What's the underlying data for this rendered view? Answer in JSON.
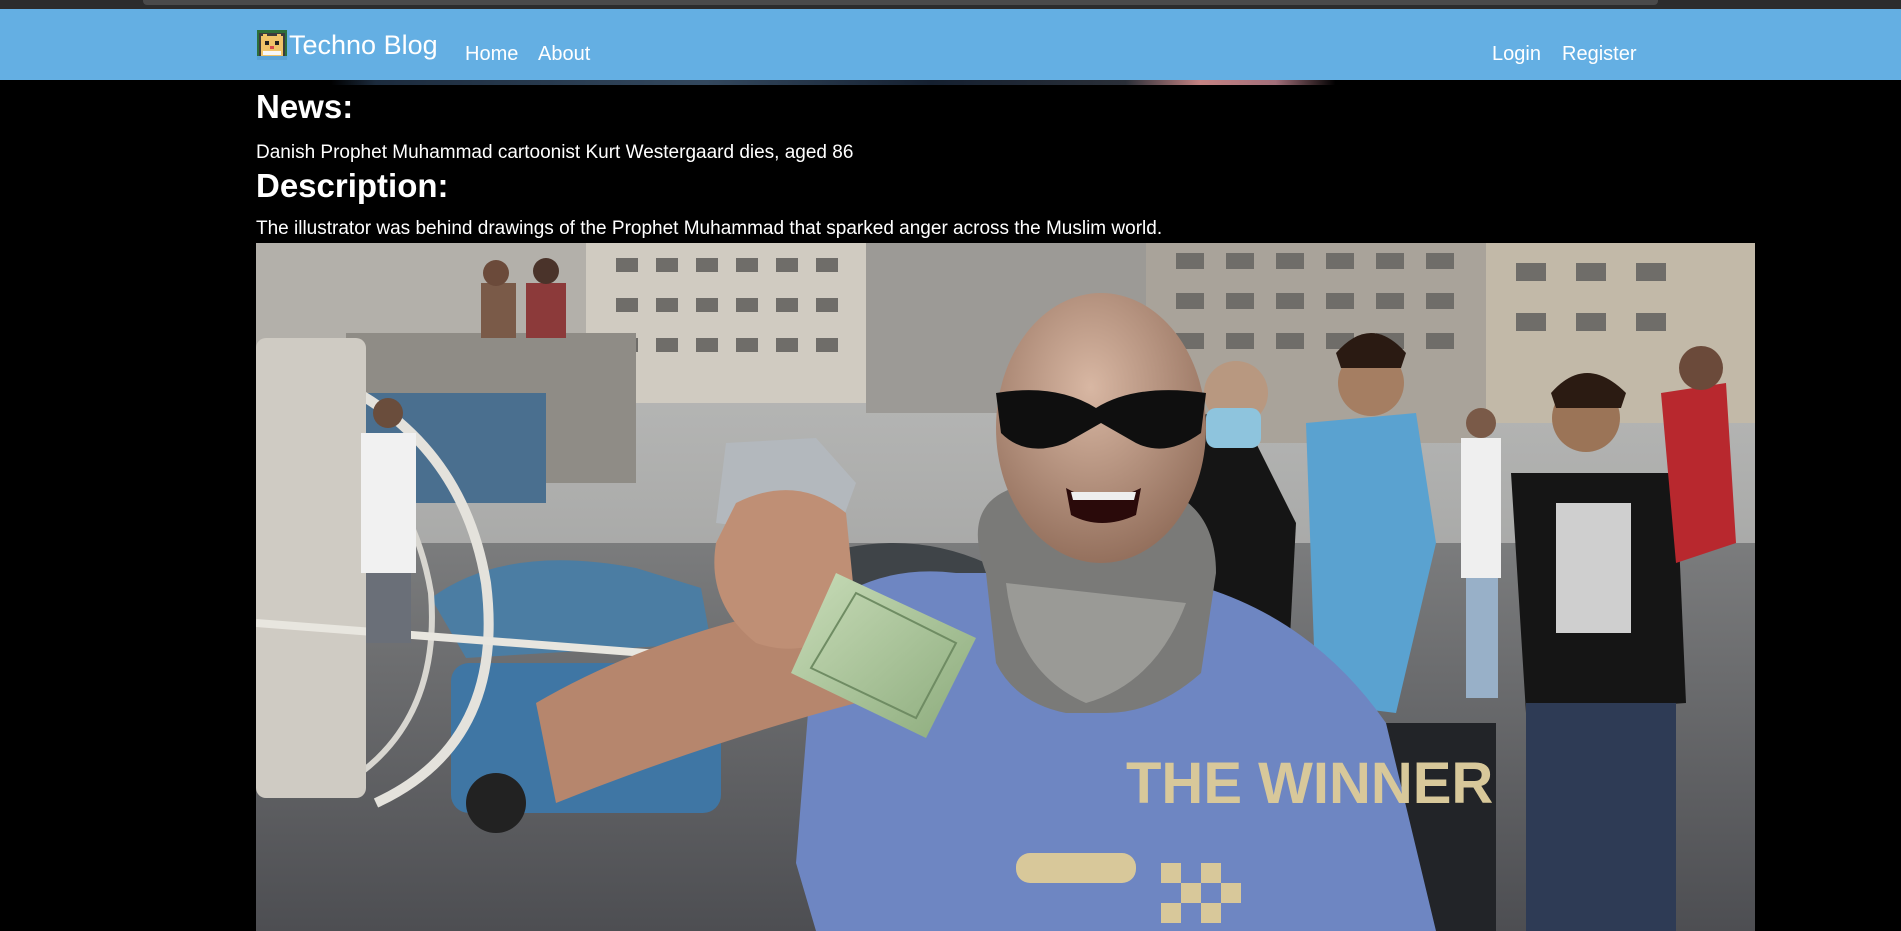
{
  "navbar": {
    "brand": "Techno Blog",
    "links_left": [
      "Home",
      "About"
    ],
    "links_right": [
      "Login",
      "Register"
    ],
    "bg_color": "#64afe3",
    "logo_icon": "pixel-cat-logo-icon"
  },
  "article": {
    "news_heading": "News:",
    "news_title": "Danish Prophet Muhammad cartoonist Kurt Westergaard dies, aged 86",
    "description_heading": "Description:",
    "description_text": "The illustrator was behind drawings of the Prophet Muhammad that sparked anger across the Muslim world."
  },
  "photo": {
    "shirt_text": "THE WINNER"
  }
}
